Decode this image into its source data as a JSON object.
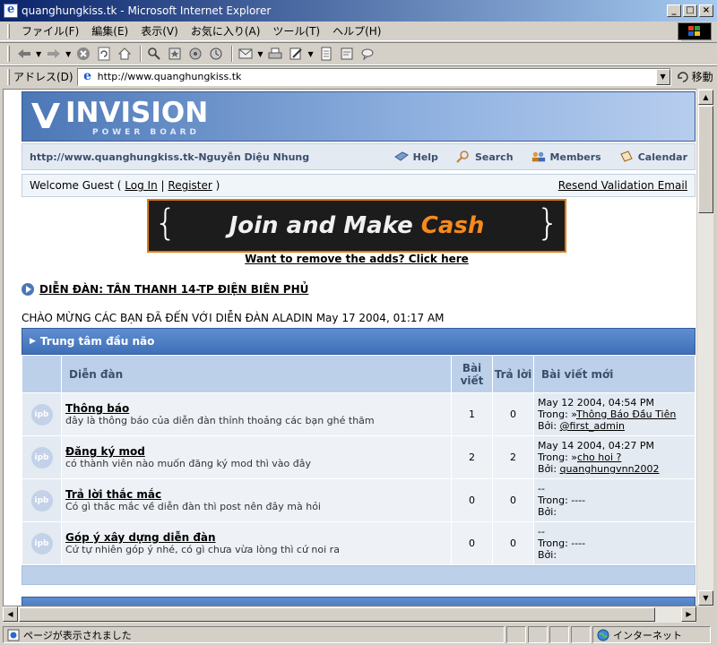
{
  "window": {
    "title": "quanghungkiss.tk - Microsoft Internet Explorer",
    "minimize": "_",
    "maximize": "□",
    "close": "×"
  },
  "menu": [
    "ファイル(F)",
    "編集(E)",
    "表示(V)",
    "お気に入り(A)",
    "ツール(T)",
    "ヘルプ(H)"
  ],
  "address": {
    "label": "アドレス(D)",
    "url": "http://www.quanghungkiss.tk",
    "go_label": "移動"
  },
  "status": {
    "text": "ページが表示されました",
    "zone": "インターネット"
  },
  "forum": {
    "logo_main": "INVISION",
    "logo_sub": "POWER BOARD",
    "site_title": "http://www.quanghungkiss.tk-Nguyễn Diệu Nhung",
    "nav": {
      "help": "Help",
      "search": "Search",
      "members": "Members",
      "calendar": "Calendar"
    },
    "user": {
      "welcome": "Welcome Guest (",
      "login": "Log In",
      "sep": "|",
      "register": "Register",
      "close": ")",
      "resend": "Resend Validation Email"
    },
    "banner": {
      "left_brace": "{",
      "text_main": "Join and Make ",
      "text_accent": "Cash",
      "right_brace": "}"
    },
    "remove_ads": "Want to remove the adds? Click here",
    "breadcrumb": "DIỄN ĐÀN: TÂN THANH 14-TP ĐIỆN BIÊN PHỦ",
    "welcome_line": "CHÀO MỪNG CÁC BẠN ĐÃ ĐẾN VỚI DIỄN ĐÀN ALADIN May 17 2004, 01:17 AM",
    "category": {
      "title": "Trung tâm đầu não",
      "col_forum": "Diễn đàn",
      "col_posts": "Bài viết",
      "col_replies": "Trả lời",
      "col_last": "Bài viết mới",
      "icon_text": "ipb",
      "rows": [
        {
          "name": "Thông báo",
          "desc": "đây là thông báo của diễn đàn thỉnh thoảng các bạn ghé thăm",
          "posts": "1",
          "replies": "0",
          "last_date": "May 12 2004, 04:54 PM",
          "last_in_label": "Trong: ",
          "last_topic": "Thông Báo Đầu Tiên",
          "last_by_label": "Bởi: ",
          "last_author": "@first_admin"
        },
        {
          "name": "Đăng ký mod",
          "desc": "có thành viên nào muốn đăng ký mod thì vào đây",
          "posts": "2",
          "replies": "2",
          "last_date": "May 14 2004, 04:27 PM",
          "last_in_label": "Trong: ",
          "last_topic": "cho hoi ?",
          "last_by_label": "Bởi: ",
          "last_author": "quanghungvnn2002"
        },
        {
          "name": "Trả lời thắc mắc",
          "desc": "Có gì thắc mắc về diễn đàn thì post nên đây mà hỏi",
          "posts": "0",
          "replies": "0",
          "last_date": "--",
          "last_in_label": "Trong: ----",
          "last_topic": "",
          "last_by_label": "Bởi:",
          "last_author": ""
        },
        {
          "name": "Góp ý xây dựng diễn đàn",
          "desc": "Cứ tự nhiên góp ý nhé, có gì chưa vừa lòng thì cứ noi ra",
          "posts": "0",
          "replies": "0",
          "last_date": "--",
          "last_in_label": "Trong: ----",
          "last_topic": "",
          "last_by_label": "Bởi:",
          "last_author": ""
        }
      ]
    }
  }
}
